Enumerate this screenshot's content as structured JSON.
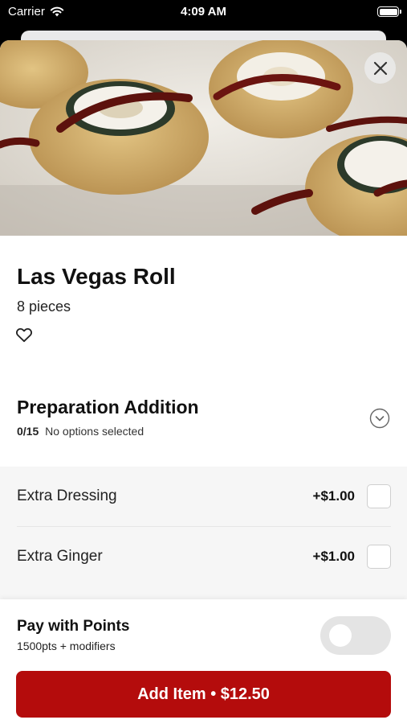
{
  "status_bar": {
    "carrier": "Carrier",
    "time": "4:09 AM"
  },
  "item": {
    "image_alt": "Las Vegas Roll sushi pieces",
    "title": "Las Vegas Roll",
    "subtitle": "8 pieces"
  },
  "icons": {
    "close": "close-icon",
    "favorite": "heart-outline-icon",
    "expand": "chevron-down-circle-icon"
  },
  "modifier_group": {
    "title": "Preparation Addition",
    "count": "0/15",
    "status": "No options selected",
    "options": [
      {
        "name": "Extra Dressing",
        "price": "+$1.00",
        "checked": false
      },
      {
        "name": "Extra Ginger",
        "price": "+$1.00",
        "checked": false
      }
    ]
  },
  "footer": {
    "points_title": "Pay with Points",
    "points_subtitle": "1500pts + modifiers",
    "points_enabled": false,
    "add_button_label": "Add Item • $12.50"
  },
  "colors": {
    "accent": "#b40c0c",
    "toggle_off": "#e4e4e4"
  }
}
